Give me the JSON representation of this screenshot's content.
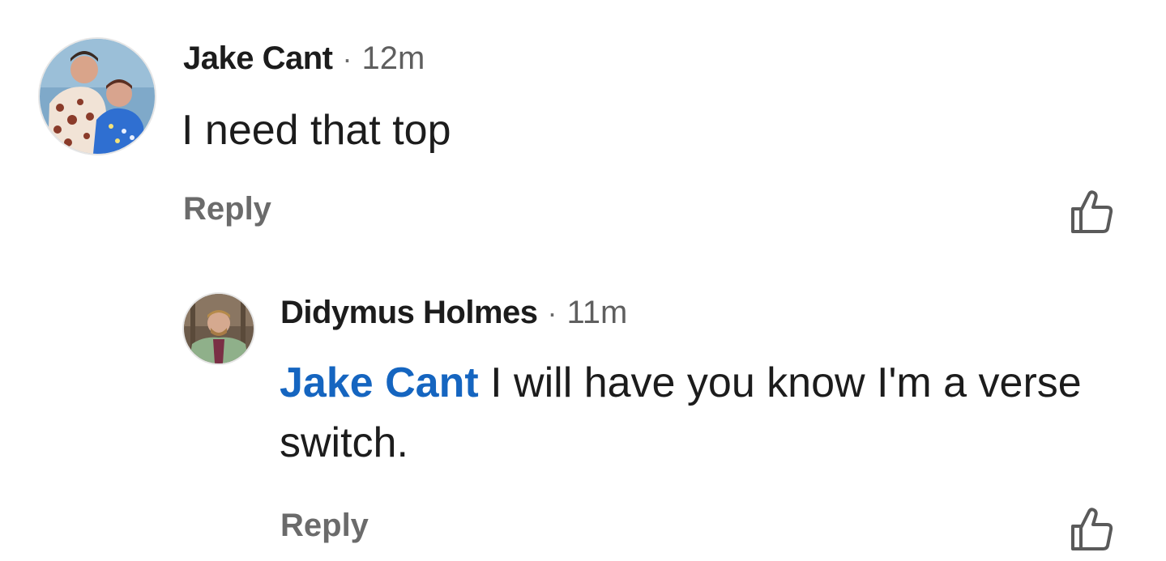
{
  "comments": [
    {
      "author": "Jake Cant",
      "time": "12m",
      "text": "I need that top",
      "reply_label": "Reply",
      "like_icon": "thumbs-up-icon",
      "avatar_icon": "profile-photo"
    },
    {
      "author": "Didymus Holmes",
      "time": "11m",
      "mention": "Jake Cant",
      "text": " I will have you know I'm a verse switch.",
      "reply_label": "Reply",
      "like_icon": "thumbs-up-icon",
      "avatar_icon": "profile-photo"
    }
  ],
  "separator": "·",
  "colors": {
    "mention": "#1565c0",
    "meta": "#6b6b6b",
    "text": "#1c1c1c"
  }
}
